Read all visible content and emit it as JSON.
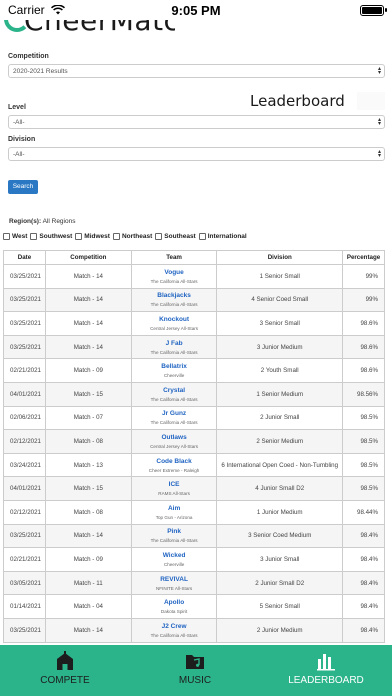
{
  "status": {
    "carrier": "Carrier",
    "time": "9:05 PM"
  },
  "brand": {
    "logo_text": "CheerMatch",
    "section_title": "Leaderboard"
  },
  "filters": {
    "competition_label": "Competition",
    "competition_value": "2020-2021 Results",
    "level_label": "Level",
    "level_value": "-All-",
    "division_label": "Division",
    "division_value": "-All-",
    "search_label": "Search"
  },
  "regions": {
    "label": "Region(s):",
    "value": "All Regions",
    "options": [
      "West",
      "Southwest",
      "Midwest",
      "Northeast",
      "Southeast",
      "International"
    ]
  },
  "table": {
    "headers": [
      "Date",
      "Competition",
      "Team",
      "Division",
      "Percentage"
    ],
    "rows": [
      {
        "date": "03/25/2021",
        "competition": "Match - 14",
        "team": "Vogue",
        "gym": "The California All-Stars",
        "division": "1 Senior Small",
        "percentage": "99%"
      },
      {
        "date": "03/25/2021",
        "competition": "Match - 14",
        "team": "Blackjacks",
        "gym": "The California All-Stars",
        "division": "4 Senior Coed Small",
        "percentage": "99%"
      },
      {
        "date": "03/25/2021",
        "competition": "Match - 14",
        "team": "Knockout",
        "gym": "Central Jersey All-Stars",
        "division": "3 Senior Small",
        "percentage": "98.6%"
      },
      {
        "date": "03/25/2021",
        "competition": "Match - 14",
        "team": "J Fab",
        "gym": "The California All-Stars",
        "division": "3 Junior Medium",
        "percentage": "98.6%"
      },
      {
        "date": "02/21/2021",
        "competition": "Match - 09",
        "team": "Bellatrix",
        "gym": "Cheerville",
        "division": "2 Youth Small",
        "percentage": "98.6%"
      },
      {
        "date": "04/01/2021",
        "competition": "Match - 15",
        "team": "Crystal",
        "gym": "The California All-Stars",
        "division": "1 Senior Medium",
        "percentage": "98.56%"
      },
      {
        "date": "02/06/2021",
        "competition": "Match - 07",
        "team": "Jr Gunz",
        "gym": "The California All-Stars",
        "division": "2 Junior Small",
        "percentage": "98.5%"
      },
      {
        "date": "02/12/2021",
        "competition": "Match - 08",
        "team": "Outlaws",
        "gym": "Central Jersey All-Stars",
        "division": "2 Senior Medium",
        "percentage": "98.5%"
      },
      {
        "date": "03/24/2021",
        "competition": "Match - 13",
        "team": "Code Black",
        "gym": "Cheer Extreme - Raleigh",
        "division": "6 International Open Coed - Non-Tumbling",
        "percentage": "98.5%"
      },
      {
        "date": "04/01/2021",
        "competition": "Match - 15",
        "team": "ICE",
        "gym": "RAMS All-Stars",
        "division": "4 Junior Small D2",
        "percentage": "98.5%"
      },
      {
        "date": "02/12/2021",
        "competition": "Match - 08",
        "team": "Aim",
        "gym": "Top Gun - Arizona",
        "division": "1 Junior Medium",
        "percentage": "98.44%"
      },
      {
        "date": "03/25/2021",
        "competition": "Match - 14",
        "team": "Pink",
        "gym": "The California All-Stars",
        "division": "3 Senior Coed Medium",
        "percentage": "98.4%"
      },
      {
        "date": "02/21/2021",
        "competition": "Match - 09",
        "team": "Wicked",
        "gym": "Cheerville",
        "division": "3 Junior Small",
        "percentage": "98.4%"
      },
      {
        "date": "03/05/2021",
        "competition": "Match - 11",
        "team": "REVIVAL",
        "gym": "NFINITE All-Stars",
        "division": "2 Junior Small D2",
        "percentage": "98.4%"
      },
      {
        "date": "01/14/2021",
        "competition": "Match - 04",
        "team": "Apollo",
        "gym": "Dakota Spirit",
        "division": "5 Senior Small",
        "percentage": "98.4%"
      },
      {
        "date": "03/25/2021",
        "competition": "Match - 14",
        "team": "J2 Crew",
        "gym": "The California All-Stars",
        "division": "2 Junior Medium",
        "percentage": "98.4%"
      }
    ]
  },
  "tabs": [
    {
      "label": "COMPETE",
      "icon": "house-icon",
      "active": false
    },
    {
      "label": "MUSIC",
      "icon": "music-folder-icon",
      "active": false
    },
    {
      "label": "LEADERBOARD",
      "icon": "bar-chart-icon",
      "active": true
    }
  ],
  "colors": {
    "accent": "#2bb38a",
    "link": "#1f63c2",
    "button": "#2a78c4"
  }
}
